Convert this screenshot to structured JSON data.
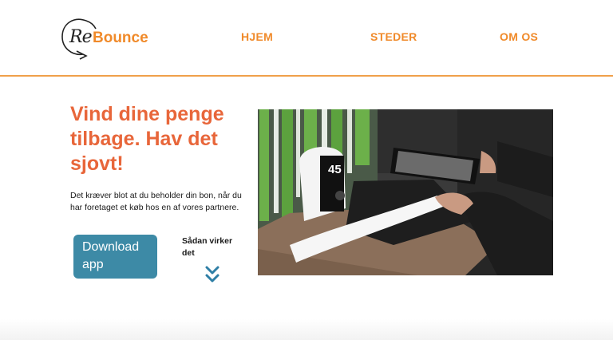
{
  "header": {
    "logo": {
      "prefix": "Re",
      "name": "Bounce"
    },
    "nav": [
      "HJEM",
      "STEDER",
      "OM OS"
    ]
  },
  "hero": {
    "headline": "Vind dine penge tilbage. Hav det sjovt!",
    "intro": "Det kræver blot at du beholder din bon, når du har foretaget et køb hos en af vores partnere.",
    "download_label": "Download app",
    "how_label": "Sådan virker det",
    "photo": {
      "table_number": "45"
    }
  },
  "colors": {
    "accent_orange": "#f08a2a",
    "headline_orange": "#e8663a",
    "button_blue": "#3d8aa6",
    "chevron_blue": "#2f7fa6"
  },
  "icons": {
    "chevrons": "double-chevron-down-icon"
  }
}
